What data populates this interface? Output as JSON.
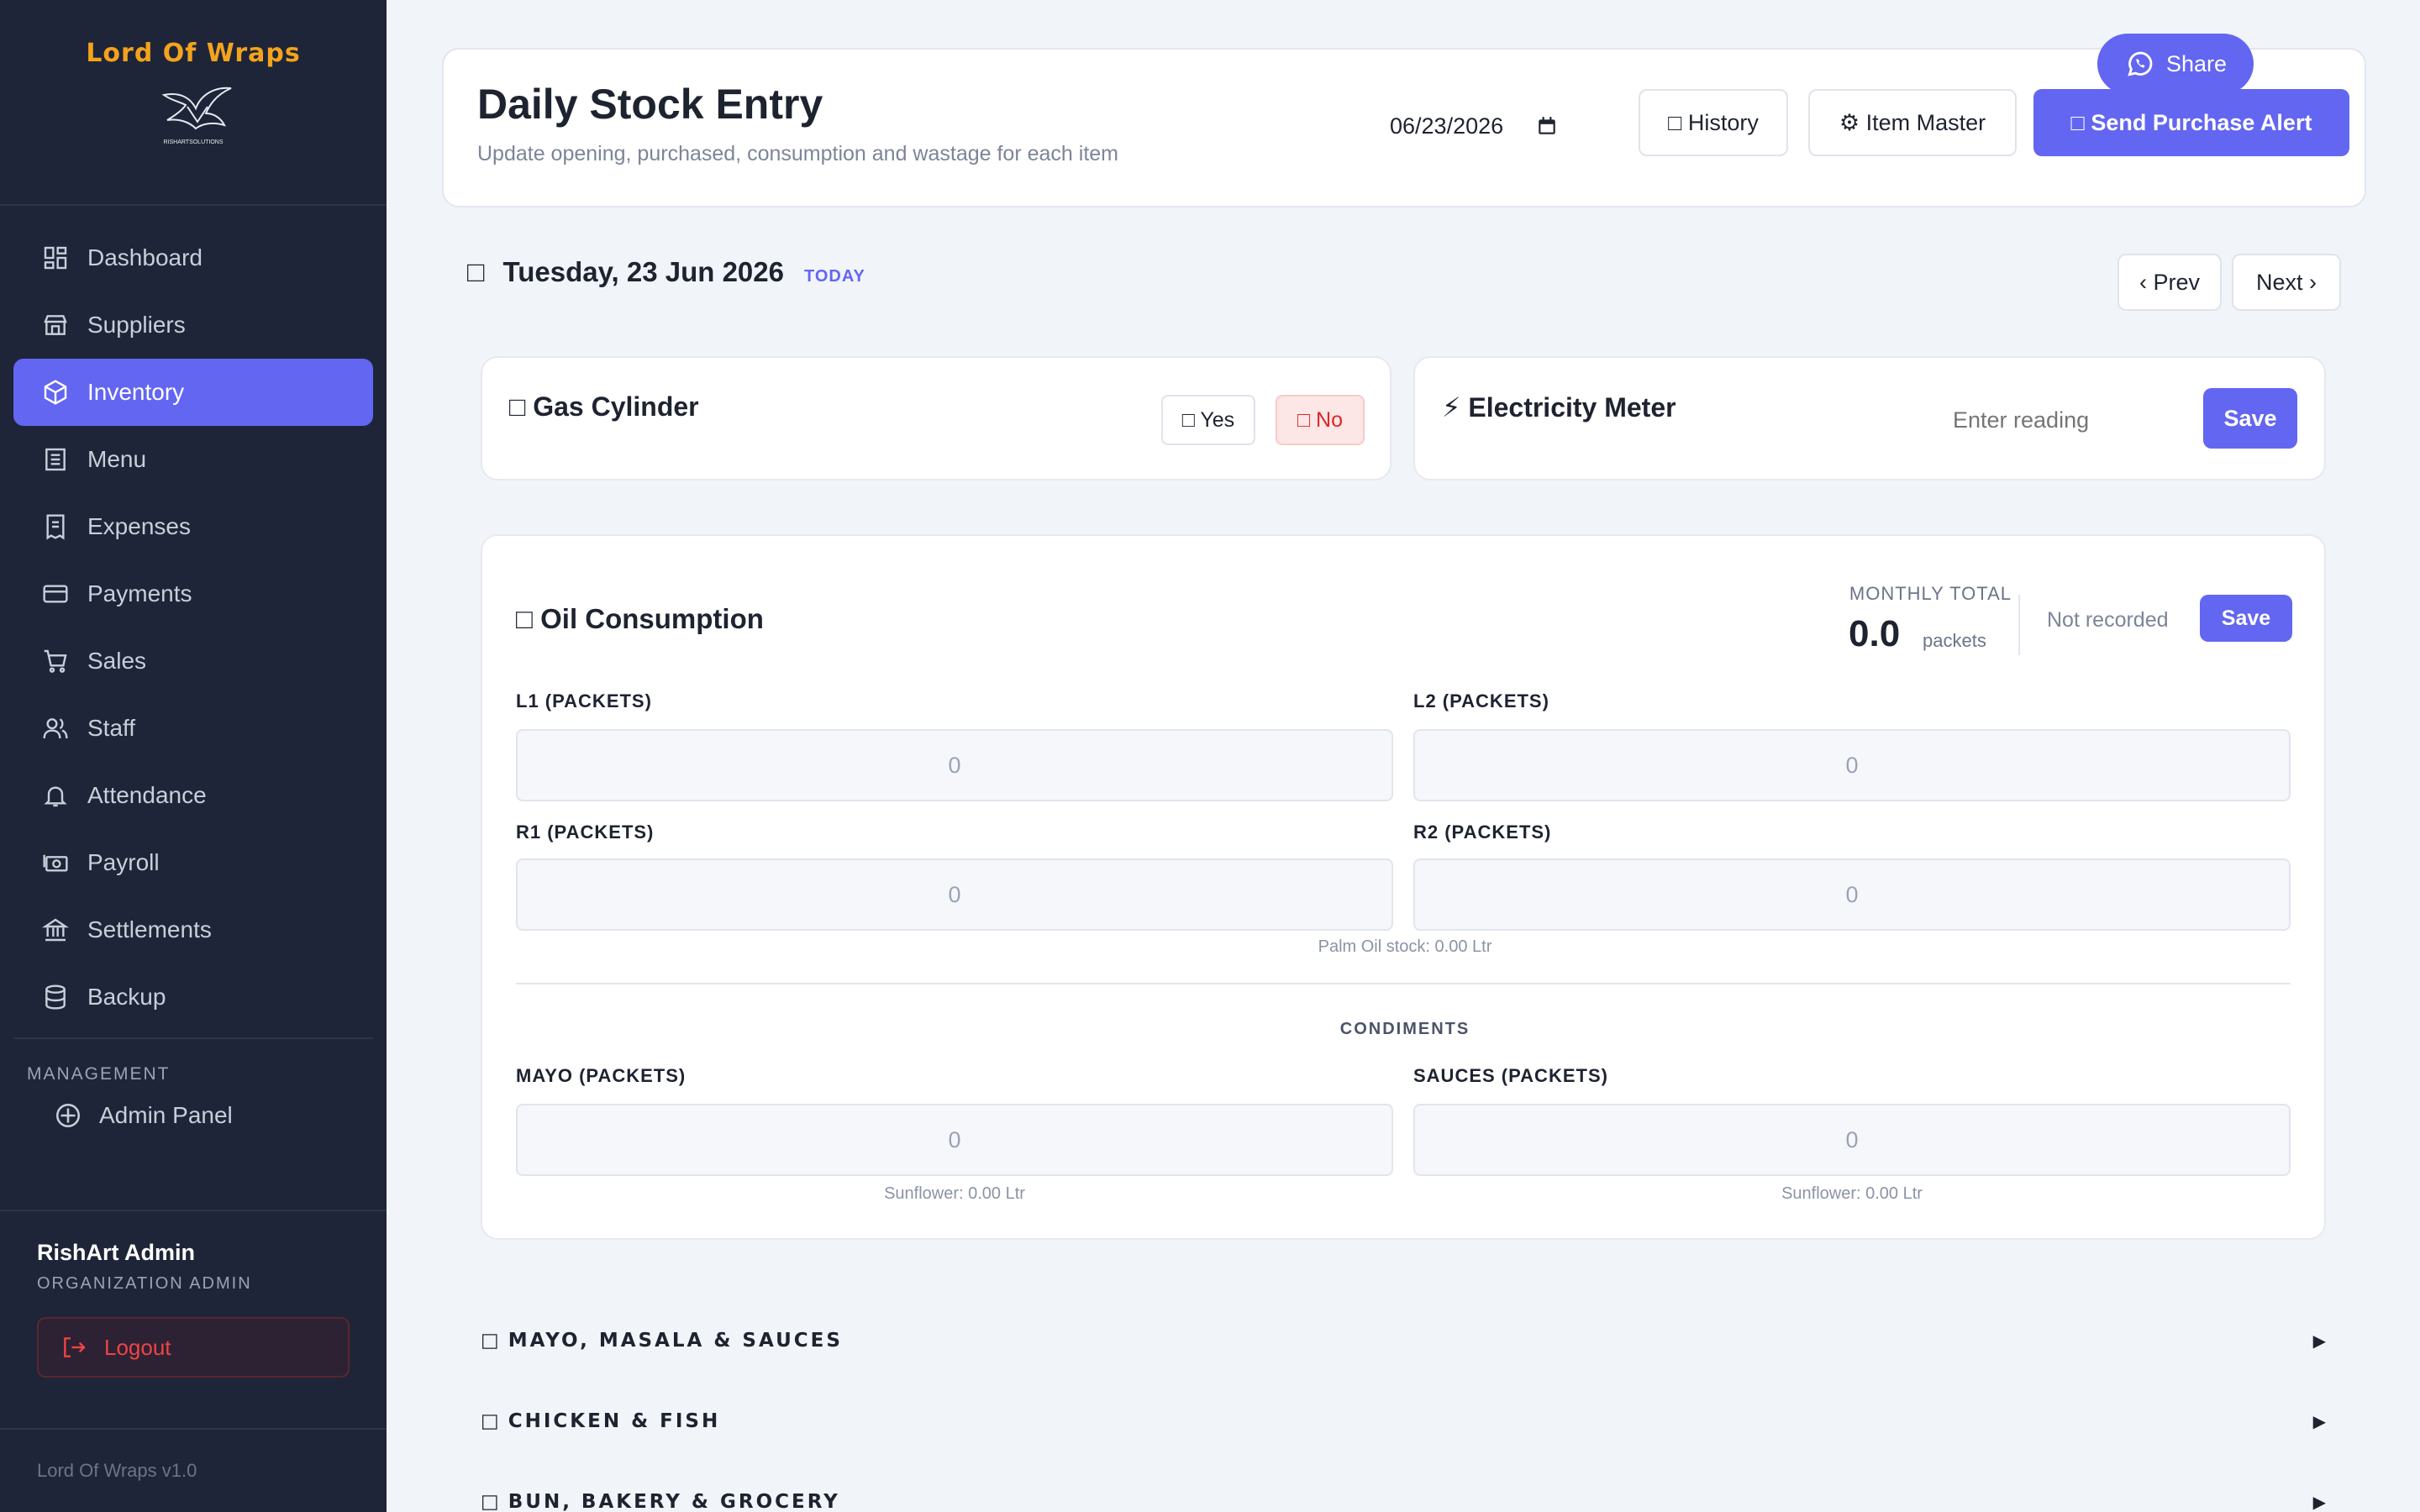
{
  "brand": {
    "name": "Lord Of Wraps",
    "logo_caption": "RISHARTSOLUTIONS"
  },
  "sidebar": {
    "items": [
      {
        "label": "Dashboard",
        "icon": "dashboard-icon"
      },
      {
        "label": "Suppliers",
        "icon": "store-icon"
      },
      {
        "label": "Inventory",
        "icon": "box-icon",
        "active": true
      },
      {
        "label": "Menu",
        "icon": "menu-list-icon"
      },
      {
        "label": "Expenses",
        "icon": "receipt-icon"
      },
      {
        "label": "Payments",
        "icon": "card-icon"
      },
      {
        "label": "Sales",
        "icon": "cart-icon"
      },
      {
        "label": "Staff",
        "icon": "users-icon"
      },
      {
        "label": "Attendance",
        "icon": "bell-icon"
      },
      {
        "label": "Payroll",
        "icon": "money-icon"
      },
      {
        "label": "Settlements",
        "icon": "bank-icon"
      },
      {
        "label": "Backup",
        "icon": "database-icon"
      }
    ],
    "management_label": "MANAGEMENT",
    "admin_panel": "Admin Panel",
    "user": {
      "name": "RishArt Admin",
      "role": "ORGANIZATION ADMIN"
    },
    "logout": "Logout",
    "version": "Lord Of Wraps v1.0"
  },
  "header": {
    "title": "Daily Stock Entry",
    "subtitle": "Update opening, purchased, consumption and wastage for each item",
    "date_value": "06/23/2026",
    "history_label": "□ History",
    "item_master_label": "⚙ Item Master",
    "send_alert_label": "□ Send Purchase Alert",
    "share_label": "Share"
  },
  "date_nav": {
    "icon": "□",
    "date_text": "Tuesday, 23 Jun 2026",
    "today_tag": "TODAY",
    "prev_label": "‹ Prev",
    "next_label": "Next ›"
  },
  "gas": {
    "title": "□ Gas Cylinder",
    "yes_label": "□ Yes",
    "no_label": "□ No"
  },
  "electricity": {
    "title": "⚡ Electricity Meter",
    "placeholder": "Enter reading",
    "save_label": "Save"
  },
  "oil": {
    "title": "□  Oil Consumption",
    "monthly_label": "MONTHLY TOTAL",
    "monthly_value": "0.0",
    "monthly_unit": "packets",
    "status": "Not recorded",
    "save_label": "Save",
    "fields": {
      "l1": {
        "label": "L1 (PACKETS)",
        "value": "0"
      },
      "l2": {
        "label": "L2 (PACKETS)",
        "value": "0"
      },
      "r1": {
        "label": "R1 (PACKETS)",
        "value": "0"
      },
      "r2": {
        "label": "R2 (PACKETS)",
        "value": "0"
      }
    },
    "palm_note": "Palm Oil stock: 0.00 Ltr",
    "condiments_label": "CONDIMENTS",
    "mayo": {
      "label": "MAYO (PACKETS)",
      "value": "0",
      "note": "Sunflower: 0.00 Ltr"
    },
    "sauces": {
      "label": "SAUCES (PACKETS)",
      "value": "0",
      "note": "Sunflower: 0.00 Ltr"
    }
  },
  "sections": [
    {
      "glyph": "□",
      "name": "MAYO, MASALA & SAUCES",
      "arrow": "▶"
    },
    {
      "glyph": "□",
      "name": "CHICKEN & FISH",
      "arrow": "▶"
    },
    {
      "glyph": "□",
      "name": "BUN, BAKERY & GROCERY",
      "arrow": "▶"
    }
  ],
  "colors": {
    "accent": "#6366f1",
    "sidebar_bg": "#1e2538",
    "brand": "#f3a31c",
    "danger": "#dc2626",
    "page_bg": "#f1f4f9"
  }
}
